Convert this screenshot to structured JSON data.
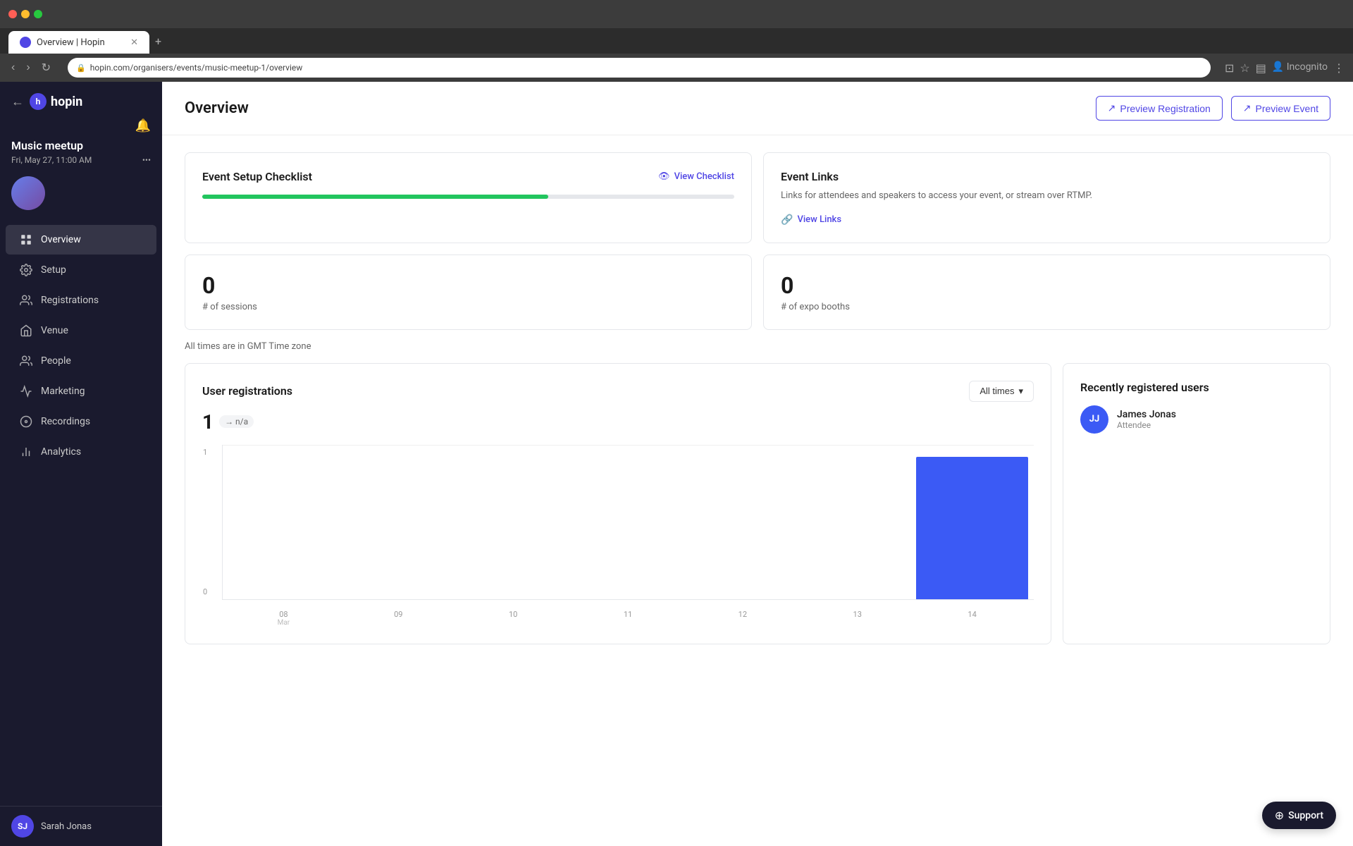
{
  "browser": {
    "tab_title": "Overview | Hopin",
    "url": "hopin.com/organisers/events/music-meetup-1/overview",
    "new_tab_label": "+"
  },
  "sidebar": {
    "back_label": "←",
    "logo": "hopin",
    "event_title": "Music meetup",
    "event_date": "Fri, May 27, 11:00 AM",
    "nav_items": [
      {
        "id": "overview",
        "label": "Overview",
        "active": true
      },
      {
        "id": "setup",
        "label": "Setup",
        "active": false
      },
      {
        "id": "registrations",
        "label": "Registrations",
        "active": false
      },
      {
        "id": "venue",
        "label": "Venue",
        "active": false
      },
      {
        "id": "people",
        "label": "People",
        "active": false
      },
      {
        "id": "marketing",
        "label": "Marketing",
        "active": false
      },
      {
        "id": "recordings",
        "label": "Recordings",
        "active": false
      },
      {
        "id": "analytics",
        "label": "Analytics",
        "active": false
      }
    ],
    "user_name": "Sarah Jonas",
    "user_initials": "SJ"
  },
  "header": {
    "title": "Overview",
    "preview_registration_label": "Preview Registration",
    "preview_event_label": "Preview Event"
  },
  "checklist": {
    "title": "Event Setup Checklist",
    "view_label": "View Checklist",
    "progress": 65
  },
  "event_links": {
    "title": "Event Links",
    "description": "Links for attendees and speakers to access your event, or stream over RTMP.",
    "view_label": "View Links"
  },
  "stats": {
    "sessions": {
      "value": "0",
      "label": "# of sessions"
    },
    "expo_booths": {
      "value": "0",
      "label": "# of expo booths"
    }
  },
  "timezone_notice": "All times are in GMT Time zone",
  "registrations": {
    "title": "User registrations",
    "count": "1",
    "badge": "→ n/a",
    "filter_label": "All times",
    "chart": {
      "y_labels": [
        "1",
        "0"
      ],
      "x_labels": [
        {
          "date": "08",
          "month": "Mar"
        },
        {
          "date": "09",
          "month": ""
        },
        {
          "date": "10",
          "month": ""
        },
        {
          "date": "11",
          "month": ""
        },
        {
          "date": "12",
          "month": ""
        },
        {
          "date": "13",
          "month": ""
        },
        {
          "date": "14",
          "month": ""
        }
      ],
      "bars": [
        0,
        0,
        0,
        0,
        0,
        0,
        1
      ]
    }
  },
  "recently_registered": {
    "title": "Recently registered users",
    "users": [
      {
        "name": "James Jonas",
        "role": "Attendee",
        "initials": "JJ",
        "color": "#3b5af5"
      }
    ]
  },
  "support": {
    "label": "Support"
  }
}
